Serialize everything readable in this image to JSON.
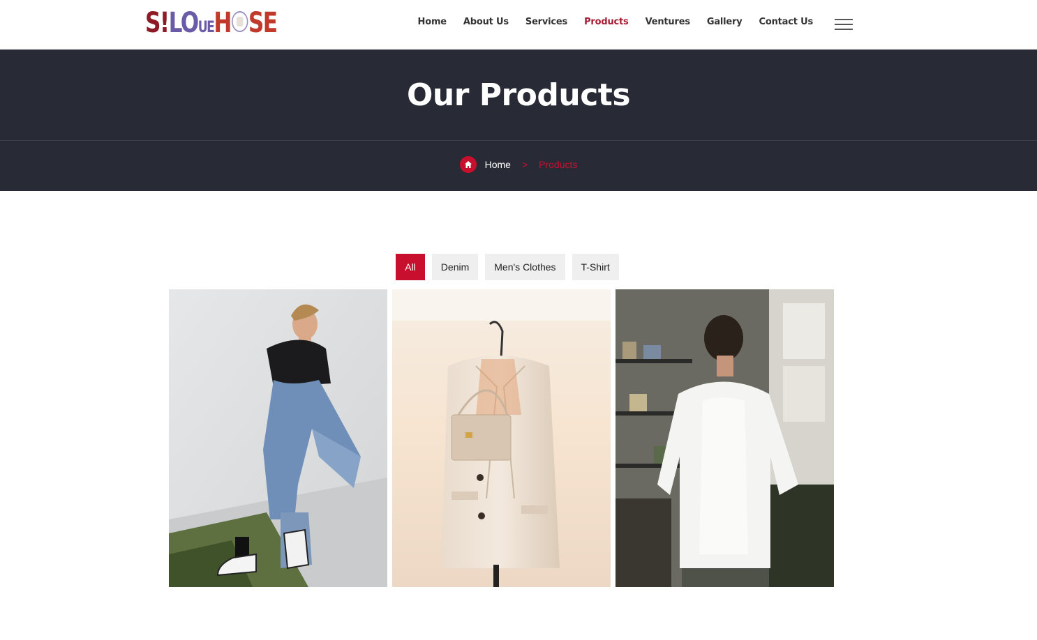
{
  "brand": {
    "logo_parts": [
      "S!",
      "LO",
      "UE",
      "H",
      "SE"
    ],
    "colors": {
      "primary": "#c8102e",
      "nav_active": "#a51c33",
      "hero_bg": "#282b36"
    }
  },
  "nav": {
    "items": [
      {
        "label": "Home",
        "active": false
      },
      {
        "label": "About Us",
        "active": false
      },
      {
        "label": "Services",
        "active": false
      },
      {
        "label": "Products",
        "active": true
      },
      {
        "label": "Ventures",
        "active": false
      },
      {
        "label": "Gallery",
        "active": false
      },
      {
        "label": "Contact Us",
        "active": false
      }
    ],
    "menu_icon": "hamburger-icon"
  },
  "hero": {
    "title": "Our Products",
    "breadcrumb": {
      "home_icon": "home-icon",
      "home": "Home",
      "separator": ">",
      "current": "Products"
    }
  },
  "filters": {
    "items": [
      {
        "label": "All",
        "active": true
      },
      {
        "label": "Denim",
        "active": false
      },
      {
        "label": "Men's Clothes",
        "active": false
      },
      {
        "label": "T-Shirt",
        "active": false
      }
    ]
  },
  "gallery": {
    "items": [
      {
        "subject": "woman-in-ripped-denim-jeans"
      },
      {
        "subject": "cream-blazer-with-handbag-on-hanger"
      },
      {
        "subject": "man-in-white-tshirt-back-view"
      }
    ]
  }
}
